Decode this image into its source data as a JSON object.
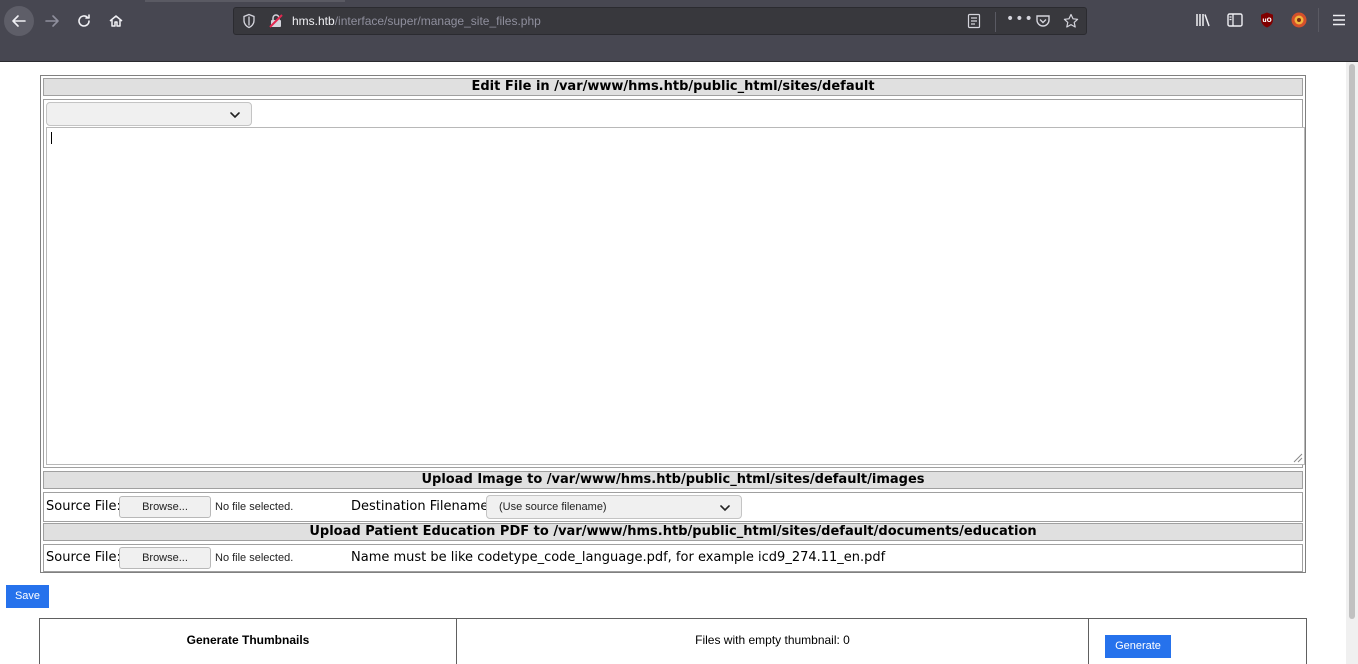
{
  "browser": {
    "url_host": "hms.htb",
    "url_path": "/interface/super/manage_site_files.php"
  },
  "edit_section": {
    "header": "Edit File in /var/www/hms.htb/public_html/sites/default",
    "file_select_value": "",
    "file_content": ""
  },
  "image_section": {
    "header": "Upload Image to /var/www/hms.htb/public_html/sites/default/images",
    "source_label": "Source File:",
    "browse_label": "Browse...",
    "no_file_text": "No file selected.",
    "dest_label": "Destination Filename:",
    "dest_select_value": "(Use source filename)"
  },
  "pdf_section": {
    "header": "Upload Patient Education PDF to /var/www/hms.htb/public_html/sites/default/documents/education",
    "source_label": "Source File:",
    "browse_label": "Browse...",
    "no_file_text": "No file selected.",
    "hint": "Name must be like codetype_code_language.pdf, for example icd9_274.11_en.pdf"
  },
  "save_label": "Save",
  "thumbnails": {
    "title": "Generate Thumbnails",
    "status": "Files with empty thumbnail: 0",
    "generate_label": "Generate"
  },
  "colors": {
    "primary_button": "#2672ec",
    "chrome_bg": "#474751",
    "section_header_bg": "#e0e0e0"
  }
}
